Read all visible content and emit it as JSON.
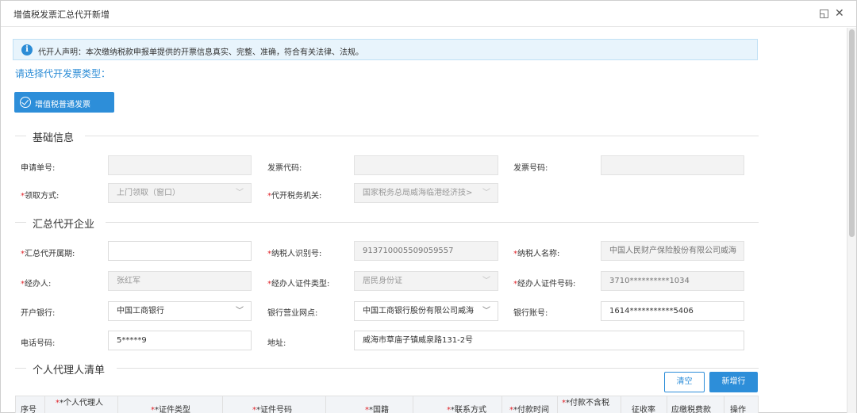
{
  "window": {
    "title": "增值税发票汇总代开新增",
    "restore_glyph": "◱",
    "close_glyph": "✕"
  },
  "notice": {
    "icon": "info-icon",
    "icon_glyph": "i",
    "text": "代开人声明：本次缴纳税款申报单提供的开票信息真实、完整、准确，符合有关法律、法规。"
  },
  "invoice_type": {
    "prompt": "请选择代开发票类型：",
    "button_label": "增值税普通发票"
  },
  "basic_info": {
    "title": "基础信息",
    "application_no": {
      "label": "申请单号:",
      "value": ""
    },
    "invoice_code": {
      "label": "发票代码:",
      "value": ""
    },
    "invoice_number": {
      "label": "发票号码:",
      "value": ""
    },
    "pickup_method": {
      "label": "领取方式:",
      "value": "上门领取（窗口）"
    },
    "tax_authority": {
      "label": "代开税务机关:",
      "value": "国家税务总局威海临港经济技>"
    }
  },
  "enterprise": {
    "title": "汇总代开企业",
    "period": {
      "label": "汇总代开属期:",
      "value": ""
    },
    "taxpayer_id": {
      "label": "纳税人识别号:",
      "value": "913710005509059557"
    },
    "taxpayer_name": {
      "label": "纳税人名称:",
      "value": "中国人民财产保险股份有限公司威海"
    },
    "handler": {
      "label": "经办人:",
      "value": "张红军"
    },
    "handler_id_type": {
      "label": "经办人证件类型:",
      "value": "居民身份证"
    },
    "handler_id_no": {
      "label": "经办人证件号码:",
      "value": "3710**********1034"
    },
    "bank": {
      "label": "开户银行:",
      "value": "中国工商银行"
    },
    "bank_branch": {
      "label": "银行营业网点:",
      "value": "中国工商银行股份有限公司威海"
    },
    "bank_account": {
      "label": "银行账号:",
      "value": "1614***********5406"
    },
    "phone": {
      "label": "电话号码:",
      "value": "5*****9"
    },
    "address": {
      "label": "地址:",
      "value": "威海市草庙子镇威泉路131-2号"
    }
  },
  "agents": {
    "title": "个人代理人清单",
    "clear_label": "清空",
    "add_label": "新增行",
    "columns": {
      "seq": "序号",
      "agent_name": "*个人代理人",
      "id_type": "*证件类型",
      "id_no": "*证件号码",
      "nationality": "*国籍",
      "contact": "*联系方式",
      "pay_time": "*付款时间",
      "pay_amount": "*付款不含税",
      "rate": "征收率",
      "tax_due": "应缴税费款",
      "ops": "操作"
    }
  }
}
